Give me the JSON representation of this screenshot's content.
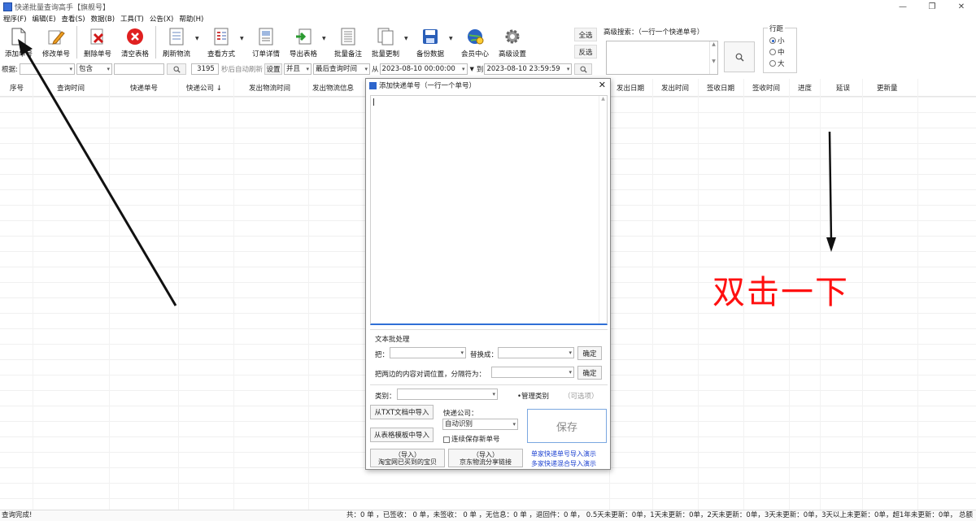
{
  "window": {
    "title": "快递批量查询高手【旗舰号】"
  },
  "menu": [
    "程序(F)",
    "编辑(E)",
    "查看(S)",
    "数据(B)",
    "工具(T)",
    "公告(X)",
    "帮助(H)"
  ],
  "toolbar": {
    "add": "添加单号",
    "edit": "修改单号",
    "delete": "删除单号",
    "clear": "清空表格",
    "refresh": "刷新物流",
    "view_mode": "查看方式",
    "order_detail": "订单详情",
    "export": "导出表格",
    "batch_note": "批量备注",
    "batch_change": "批量更制",
    "backup": "备份数据",
    "member": "会员中心",
    "advanced": "高级设置",
    "select_all": "全选",
    "invert": "反选"
  },
  "advanced_search": {
    "label": "高级搜索：（一行一个快递单号）"
  },
  "row_spacing": {
    "title": "行距",
    "options": [
      "小",
      "中",
      "大"
    ],
    "selected": "小"
  },
  "filter": {
    "by_label": "根据:",
    "by_value": "",
    "match": "包含",
    "keyword": "",
    "count": "3195",
    "auto_refresh_label": "秒后自动刷新",
    "settings": "设置",
    "share": "并且",
    "time_field": "最后查询时间",
    "from_label": "从",
    "from": "2023-08-10 00:00:00",
    "to_label": "到",
    "to": "2023-08-10 23:59:59"
  },
  "columns": [
    "序号",
    "查询时间",
    "快递单号",
    "快递公司 ↓",
    "发出物流时间",
    "发出物流信息",
    "发出日期",
    "发出时间",
    "签收日期",
    "签收时间",
    "进度",
    "延误",
    "更新量"
  ],
  "dialog": {
    "title": "添加快递单号（一行一个单号）",
    "text_section": "文本批处理",
    "replace_from": "把：",
    "replace_to": "替换成：",
    "confirm": "确定",
    "swap_label": "把两边的内容对调位置，分隔符为：",
    "confirm2": "确定",
    "category_label": "类别：",
    "manage_category": "•管理类别",
    "optional": "（可选项）",
    "import_txt": "从TXT文档中导入",
    "import_table": "从表格模板中导入",
    "courier_label": "快递公司：",
    "courier_value": "自动识别",
    "continuous": "连续保存新单号",
    "save": "保存",
    "taobao_line1": "（导入）",
    "taobao_line2": "淘宝网已买到的宝贝",
    "jd_line1": "（导入）",
    "jd_line2": "京东物流分享链接",
    "demo_single": "单家快递单号导入演示",
    "demo_multi": "多家快递混合导入演示"
  },
  "status": {
    "left": "查询完成!",
    "right": "共：0 单 ，已签收： 0 单，未签收： 0 单 ，无信息：0 单 ，退回件：0 单， 0.5天未更新：0单，1天未更新：0单，2天未更新：0单，3天未更新：0单，3天以上未更新：0单，超1年未更新：0单， 总额"
  },
  "annotation": "双击一下",
  "colors": {
    "accent": "#2f6fd6",
    "annotation": "#ff1010",
    "link": "#1a3fd0"
  }
}
